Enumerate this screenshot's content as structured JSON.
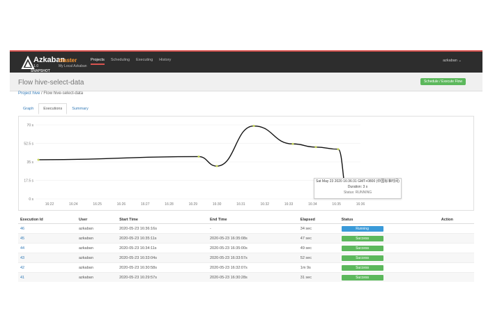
{
  "nav": {
    "brand": "Azkaban",
    "version": "3.1.0",
    "snapshot": "SNAPSHOT",
    "env": "master",
    "env_sub": "My Local Azkaban",
    "items": [
      "Projects",
      "Scheduling",
      "Executing",
      "History"
    ],
    "user": "azkaban ⌄"
  },
  "header": {
    "title": "Flow hive-select-data",
    "schedule_button": "Schedule / Execute Flow"
  },
  "breadcrumb": {
    "project_link": "Project hive",
    "separator": "/",
    "flow": "Flow hive-select-data"
  },
  "tabs": [
    "Graph",
    "Executions",
    "Summary"
  ],
  "chart_data": {
    "type": "line",
    "y_ticks": [
      "70 s",
      "52.5 s",
      "35 s",
      "17.5 s",
      "0 s"
    ],
    "x_ticks": [
      "16:22",
      "16:24",
      "16:25",
      "16:26",
      "16:27",
      "16:28",
      "16:29",
      "16:30",
      "16:31",
      "16:32",
      "16:33",
      "16:34",
      "16:35",
      "16:36"
    ],
    "ylim": [
      0,
      70
    ],
    "points": [
      {
        "t": "16:22",
        "v": 37
      },
      {
        "t": "16:29",
        "v": 40
      },
      {
        "t": "16:30",
        "v": 31
      },
      {
        "t": "16:32",
        "v": 69
      },
      {
        "t": "16:34",
        "v": 52
      },
      {
        "t": "16:35",
        "v": 49
      },
      {
        "t": "16:35",
        "v": 47
      },
      {
        "t": "16:36",
        "v": 3
      }
    ]
  },
  "tooltip": {
    "line1": "Sat May 23 2020 16:36:31 GMT+0800 (中国标准时间)",
    "line2": "Duration: 3 s",
    "line3": "Status: RUNNING"
  },
  "table": {
    "headers": [
      "Execution Id",
      "User",
      "Start Time",
      "End Time",
      "Elapsed",
      "Status",
      "Action"
    ],
    "rows": [
      {
        "id": "46",
        "user": "azkaban",
        "start": "2020-05-23 16:36:16s",
        "end": "-",
        "elapsed": "34 sec",
        "status": "Running",
        "kind": "running"
      },
      {
        "id": "45",
        "user": "azkaban",
        "start": "2020-05-23 16:35:11s",
        "end": "2020-05-23 16:35:08s",
        "elapsed": "47 sec",
        "status": "Success",
        "kind": "success"
      },
      {
        "id": "44",
        "user": "azkaban",
        "start": "2020-05-23 16:34:11s",
        "end": "2020-05-23 16:35:00s",
        "elapsed": "49 sec",
        "status": "Success",
        "kind": "success"
      },
      {
        "id": "43",
        "user": "azkaban",
        "start": "2020-05-23 16:33:04s",
        "end": "2020-05-23 16:33:57s",
        "elapsed": "52 sec",
        "status": "Success",
        "kind": "success"
      },
      {
        "id": "42",
        "user": "azkaban",
        "start": "2020-05-23 16:30:58s",
        "end": "2020-05-23 16:32:07s",
        "elapsed": "1m 9s",
        "status": "Success",
        "kind": "success"
      },
      {
        "id": "41",
        "user": "azkaban",
        "start": "2020-05-23 16:29:57s",
        "end": "2020-05-23 16:30:28s",
        "elapsed": "31 sec",
        "status": "Success",
        "kind": "success"
      }
    ]
  }
}
